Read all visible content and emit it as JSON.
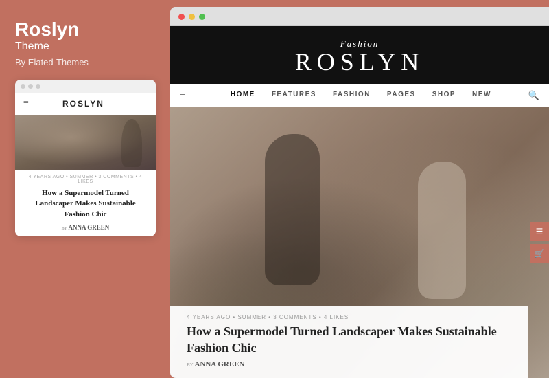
{
  "left": {
    "theme_title": "Roslyn",
    "theme_subtitle": "Theme",
    "theme_by": "By Elated-Themes",
    "mobile_preview": {
      "dots": [
        "dot1",
        "dot2",
        "dot3"
      ],
      "nav_logo": "ROSLYN",
      "post_meta": "4 YEARS AGO • SUMMER • 3 COMMENTS • 4 LIKES",
      "post_title": "How a Supermodel Turned Landscaper Makes Sustainable Fashion Chic",
      "post_author_prefix": "by",
      "post_author": "ANNA GREEN"
    }
  },
  "right": {
    "browser_dots": [
      "red",
      "yellow",
      "green"
    ],
    "site": {
      "logo_script": "Fashion",
      "logo_main": "ROSLYN",
      "nav_items": [
        {
          "label": "HOME",
          "active": true
        },
        {
          "label": "FEATURES",
          "active": false
        },
        {
          "label": "FASHION",
          "active": false
        },
        {
          "label": "PAGES",
          "active": false
        },
        {
          "label": "SHOP",
          "active": false
        },
        {
          "label": "NEW",
          "active": false
        }
      ],
      "article": {
        "meta": "4 YEARS AGO • SUMMER • 3 COMMENTS • 4 LIKES",
        "title": "How a Supermodel Turned Landscaper Makes Sustainable Fashion Chic",
        "author_prefix": "by",
        "author": "ANNA GREEN"
      },
      "fab": {
        "icon1": "☰",
        "icon2": "🛒"
      }
    }
  },
  "colors": {
    "accent": "#c17060",
    "dark": "#111111",
    "white": "#ffffff"
  }
}
